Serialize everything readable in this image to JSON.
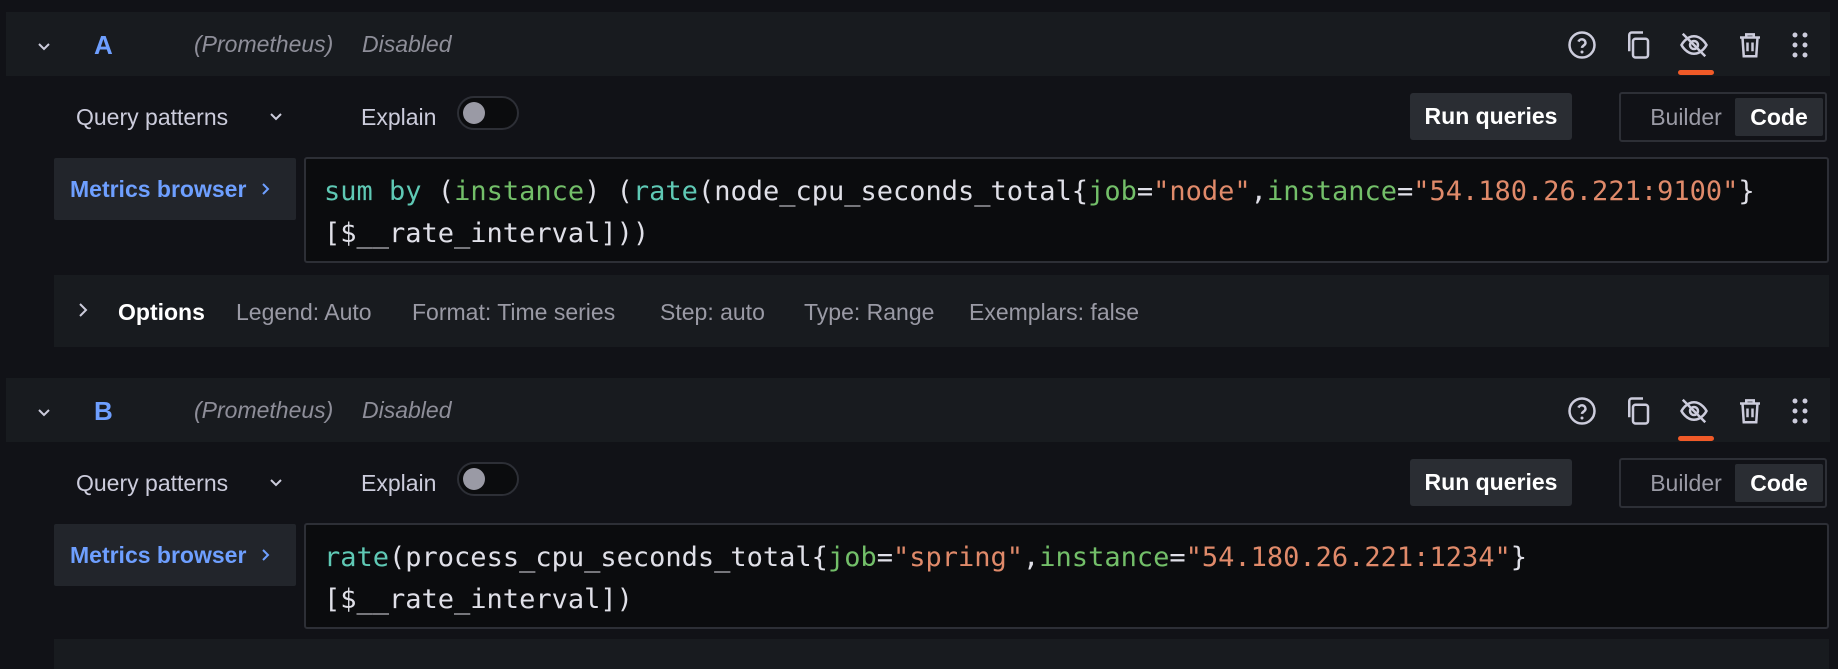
{
  "colors": {
    "background": "#111217",
    "panel": "#181b1f",
    "accent_blue": "#6e9fff",
    "hide_indicator": "#f05a28",
    "code_function": "#5fc9b5",
    "code_label": "#73bf69",
    "code_string": "#e08a6a"
  },
  "queries": [
    {
      "letter": "A",
      "datasource": "(Prometheus)",
      "status": "Disabled",
      "query_patterns_label": "Query patterns",
      "explain_label": "Explain",
      "explain_enabled": false,
      "run_label": "Run queries",
      "mode_builder": "Builder",
      "mode_code": "Code",
      "mode_selected": "Code",
      "metrics_browser_label": "Metrics browser",
      "code": {
        "t1": "sum",
        "t2": " ",
        "t3": "by",
        "t4": " (",
        "t5": "instance",
        "t6": ") (",
        "t7": "rate",
        "t8": "(node_cpu_seconds_total{",
        "t9": "job",
        "t10": "=",
        "t11": "\"node\"",
        "t12": ",",
        "t13": "instance",
        "t14": "=",
        "t15": "\"54.180.26.221:9100\"",
        "t16": "}",
        "line2": "[$__rate_interval]))"
      },
      "options": {
        "title": "Options",
        "legend": "Legend: Auto",
        "format": "Format: Time series",
        "step": "Step: auto",
        "type": "Type: Range",
        "exemplars": "Exemplars: false"
      }
    },
    {
      "letter": "B",
      "datasource": "(Prometheus)",
      "status": "Disabled",
      "query_patterns_label": "Query patterns",
      "explain_label": "Explain",
      "explain_enabled": false,
      "run_label": "Run queries",
      "mode_builder": "Builder",
      "mode_code": "Code",
      "mode_selected": "Code",
      "metrics_browser_label": "Metrics browser",
      "code": {
        "t1": "rate",
        "t2": "(process_cpu_seconds_total{",
        "t3": "job",
        "t4": "=",
        "t5": "\"spring\"",
        "t6": ",",
        "t7": "instance",
        "t8": "=",
        "t9": "\"54.180.26.221:1234\"",
        "t10": "}",
        "line2": "[$__rate_interval])"
      }
    }
  ],
  "icons": {
    "collapse": "chevron-down-icon",
    "help": "question-circle-icon",
    "copy": "copy-icon",
    "hide": "eye-slash-icon",
    "delete": "trash-icon",
    "drag": "drag-handle-icon",
    "metrics_chevron": "chevron-right-icon",
    "options_chevron": "chevron-right-icon"
  }
}
